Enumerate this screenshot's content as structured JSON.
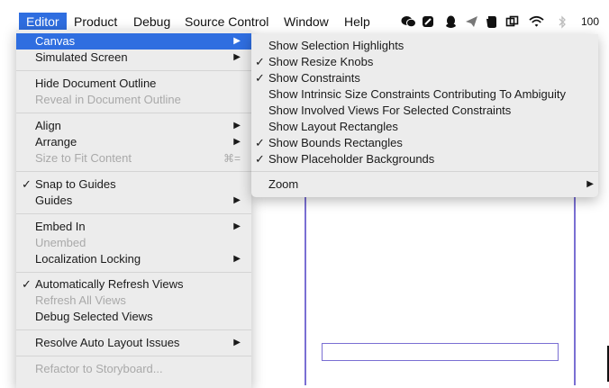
{
  "menubar": {
    "items": [
      "Editor",
      "Product",
      "Debug",
      "Source Control",
      "Window",
      "Help"
    ],
    "battery": "100",
    "icons": [
      "wechat-icon",
      "app-icon",
      "qq-icon",
      "send-icon",
      "evernote-icon",
      "screenshot-icon",
      "wifi-icon",
      "bluetooth-icon"
    ]
  },
  "editor_menu": {
    "canvas": "Canvas",
    "simulated_screen": "Simulated Screen",
    "hide_outline": "Hide Document Outline",
    "reveal_outline": "Reveal in Document Outline",
    "align": "Align",
    "arrange": "Arrange",
    "size_to_fit": "Size to Fit Content",
    "size_to_fit_shortcut": "⌘=",
    "snap_to_guides": "Snap to Guides",
    "guides": "Guides",
    "embed_in": "Embed In",
    "unembed": "Unembed",
    "localization_locking": "Localization Locking",
    "auto_refresh": "Automatically Refresh Views",
    "refresh_all": "Refresh All Views",
    "debug_selected": "Debug Selected Views",
    "resolve_auto_layout": "Resolve Auto Layout Issues",
    "refactor": "Refactor to Storyboard..."
  },
  "canvas_submenu": {
    "selection_highlights": "Show Selection Highlights",
    "resize_knobs": "Show Resize Knobs",
    "constraints": "Show Constraints",
    "intrinsic_size": "Show Intrinsic Size Constraints Contributing To Ambiguity",
    "involved_views": "Show Involved Views For Selected Constraints",
    "layout_rectangles": "Show Layout Rectangles",
    "bounds_rectangles": "Show Bounds Rectangles",
    "placeholder_backgrounds": "Show Placeholder Backgrounds",
    "zoom": "Zoom"
  },
  "glyphs": {
    "check": "✓",
    "arrow": "▶"
  },
  "colors": {
    "highlight": "#2f6ee0",
    "scene_outline": "#7a6fd3"
  }
}
